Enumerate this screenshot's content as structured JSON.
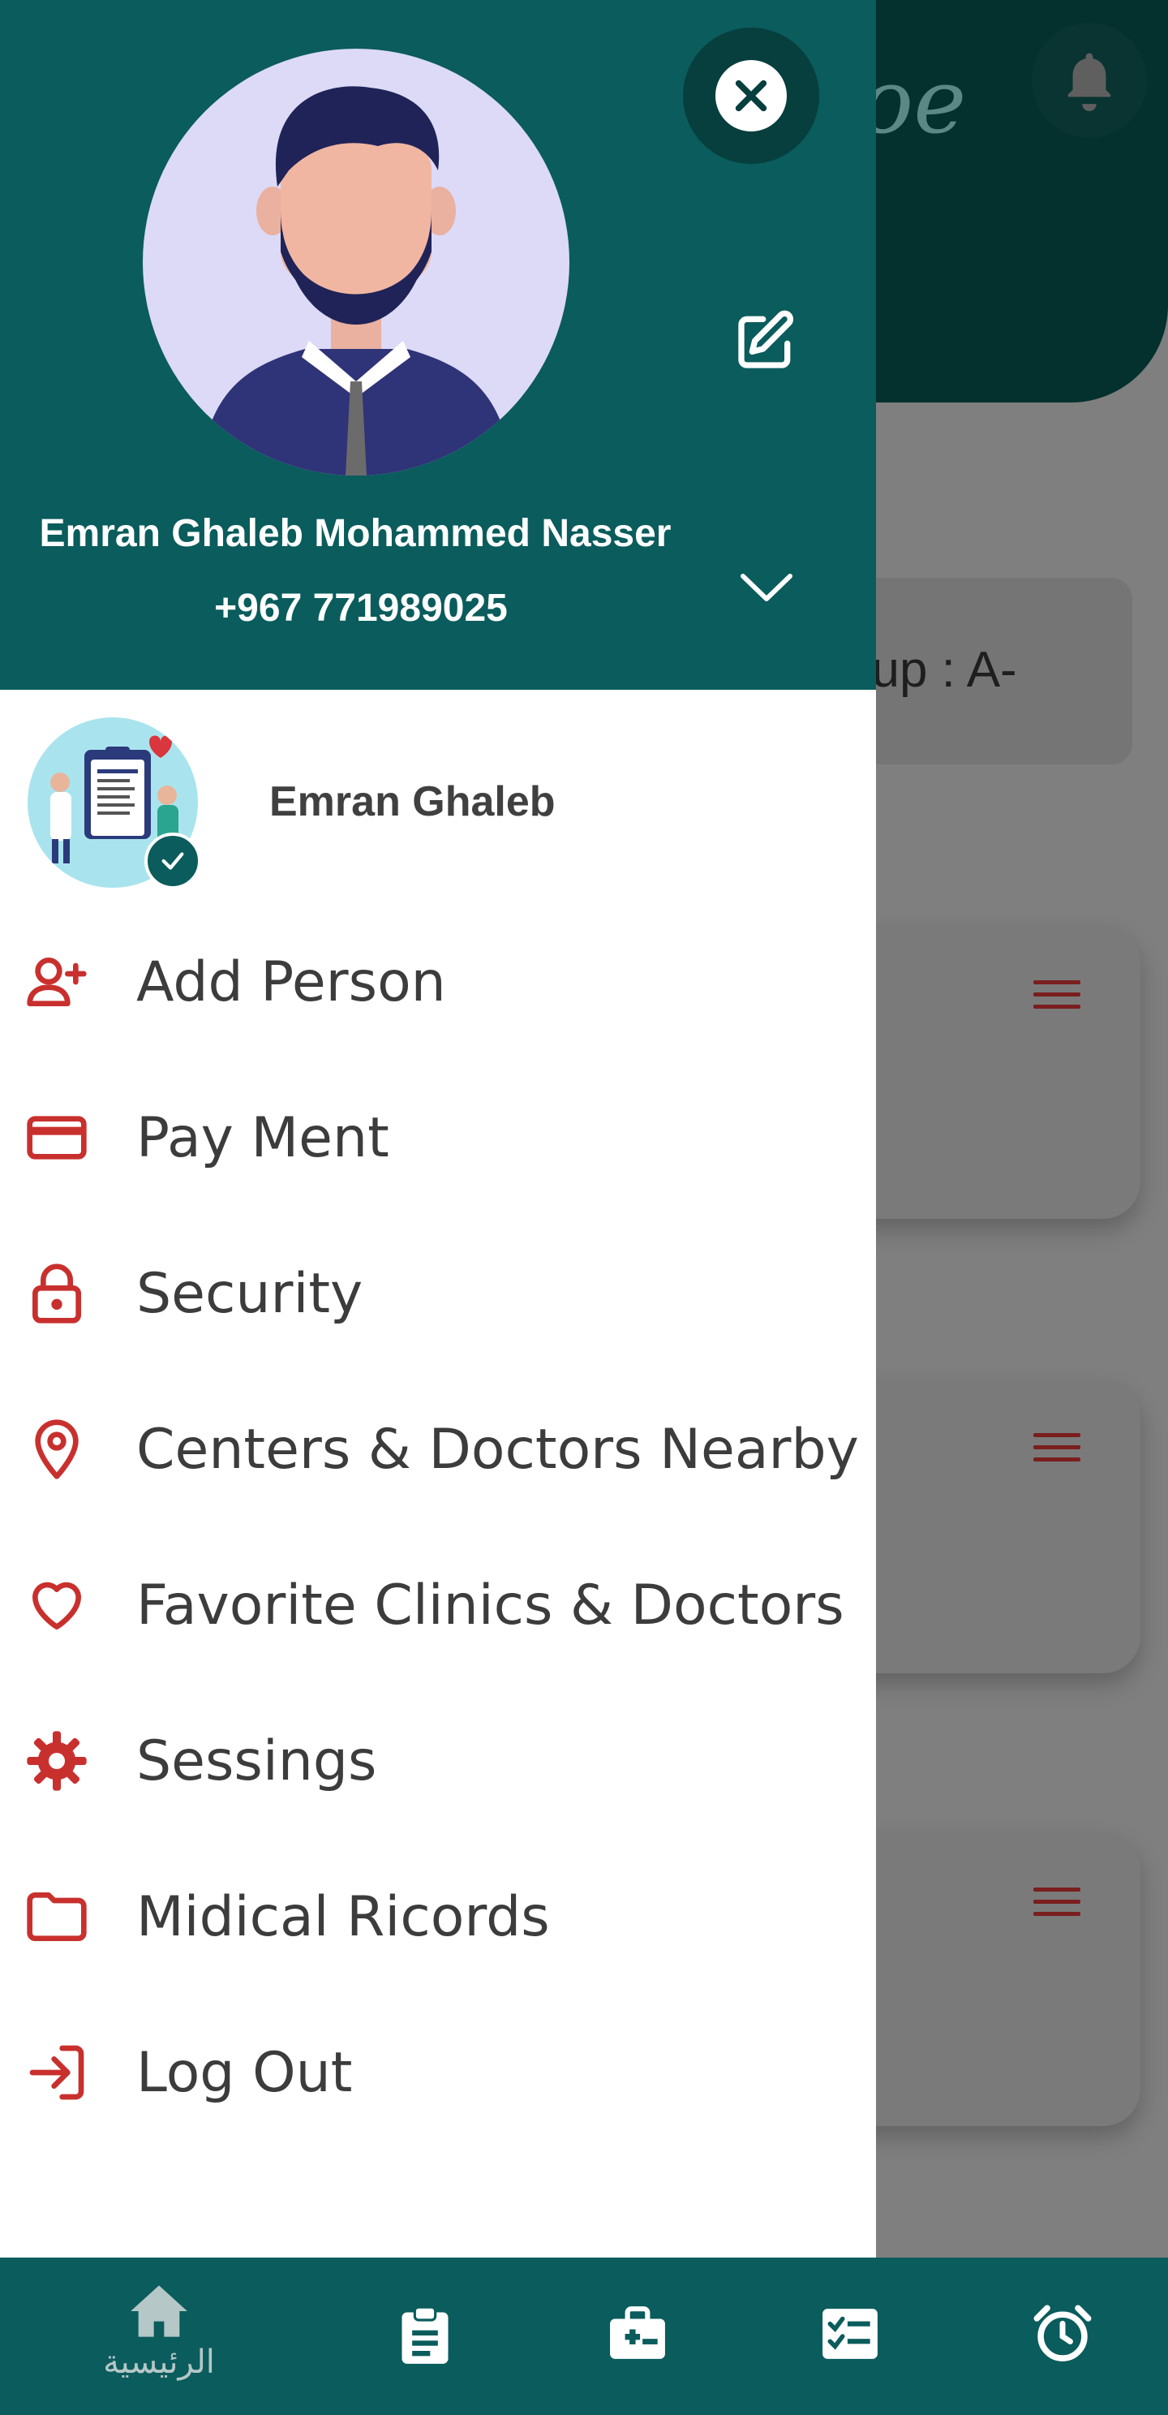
{
  "colors": {
    "primary": "#0b5c5c",
    "primary_dark": "#063f3d",
    "accent_red": "#c8302e",
    "text_dark": "#3c3c3c"
  },
  "background": {
    "blood_group_text": "oup : A-"
  },
  "drawer": {
    "header": {
      "full_name": "Emran Ghaleb Mohammed Nasser",
      "phone": "+967 771989025"
    },
    "account": {
      "name": "Emran Ghaleb"
    },
    "menu": [
      {
        "label": "Add Person",
        "icon": "add-person-icon"
      },
      {
        "label": "Pay Ment",
        "icon": "credit-card-icon"
      },
      {
        "label": "Security",
        "icon": "lock-icon"
      },
      {
        "label": "Centers & Doctors Nearby",
        "icon": "location-pin-icon"
      },
      {
        "label": "Favorite Clinics & Doctors",
        "icon": "heart-icon"
      },
      {
        "label": "Sessings",
        "icon": "gear-icon"
      },
      {
        "label": "Midical Ricords",
        "icon": "folder-icon"
      },
      {
        "label": "Log Out",
        "icon": "logout-icon"
      }
    ]
  },
  "bottom_nav": {
    "items": [
      {
        "label": "الرئيسية",
        "icon": "home-icon"
      },
      {
        "label": "",
        "icon": "clipboard-icon"
      },
      {
        "label": "",
        "icon": "medical-kit-icon"
      },
      {
        "label": "",
        "icon": "checklist-icon"
      },
      {
        "label": "",
        "icon": "alarm-clock-icon"
      }
    ]
  }
}
